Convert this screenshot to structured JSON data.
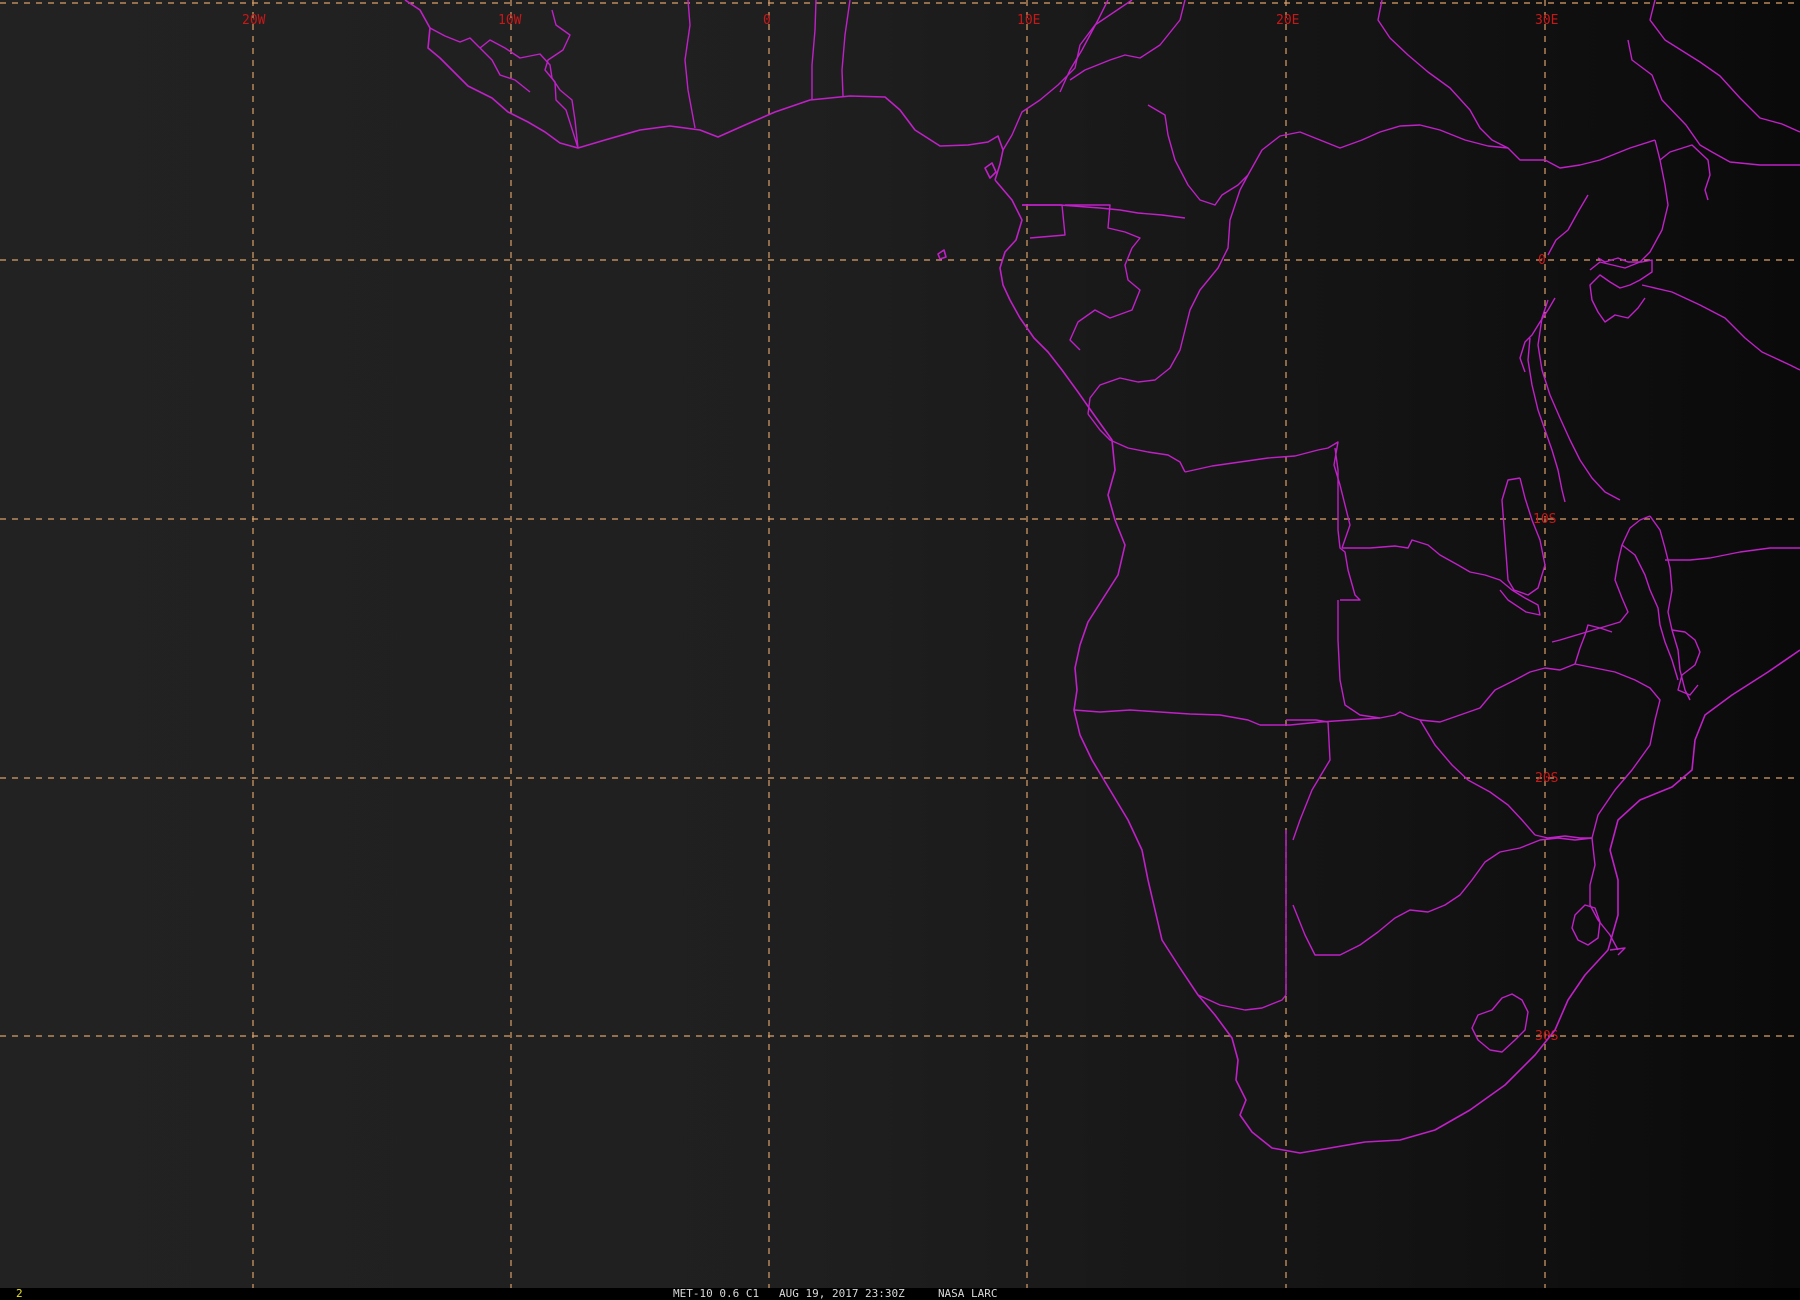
{
  "map": {
    "title": "MET-10 0.6 C1",
    "longitude_labels": [
      "20W",
      "10W",
      "0",
      "10E",
      "20E",
      "30E"
    ],
    "latitude_labels": [
      "0",
      "10S",
      "20S",
      "30S"
    ],
    "colors": {
      "background": "#1e1e1e",
      "grid": "#d9a06a",
      "grid_label": "#c81818",
      "boundaries": "#c020c8"
    }
  },
  "status_bar": {
    "frame_number": "2",
    "satellite": "MET-10 0.6 C1",
    "timestamp": "AUG 19, 2017 23:30Z",
    "source": "NASA LARC"
  }
}
